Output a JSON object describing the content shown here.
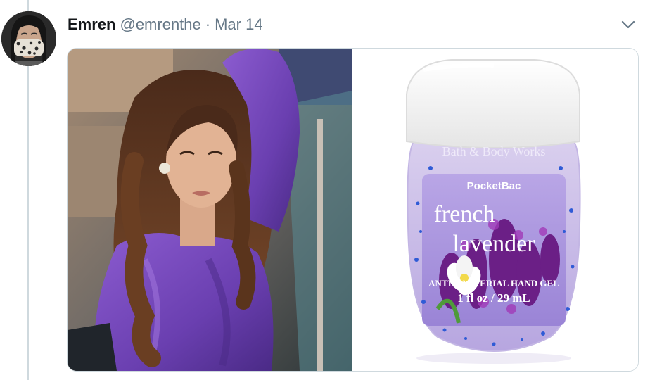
{
  "tweet": {
    "author": {
      "display_name": "Emren",
      "handle": "@emrenthe",
      "avatar_icon": "avatar-masked-person"
    },
    "separator": "·",
    "timestamp": "Mar 14",
    "menu_icon": "chevron-down-icon",
    "media": {
      "images": [
        {
          "icon": "photo-woman-purple-dress"
        },
        {
          "icon": "photo-hand-sanitizer",
          "product": {
            "brand_top": "Bath & Body Works",
            "line": "PocketBac",
            "name_line1": "french",
            "name_line2": "lavender",
            "descriptor": "ANTI-BACTERIAL HAND GEL",
            "size": "1 fl oz / 29 mL"
          }
        }
      ]
    }
  },
  "colors": {
    "name": "#14171a",
    "secondary": "#657786",
    "border": "#cfd9de",
    "accent_purple": "#7a4fc0"
  }
}
